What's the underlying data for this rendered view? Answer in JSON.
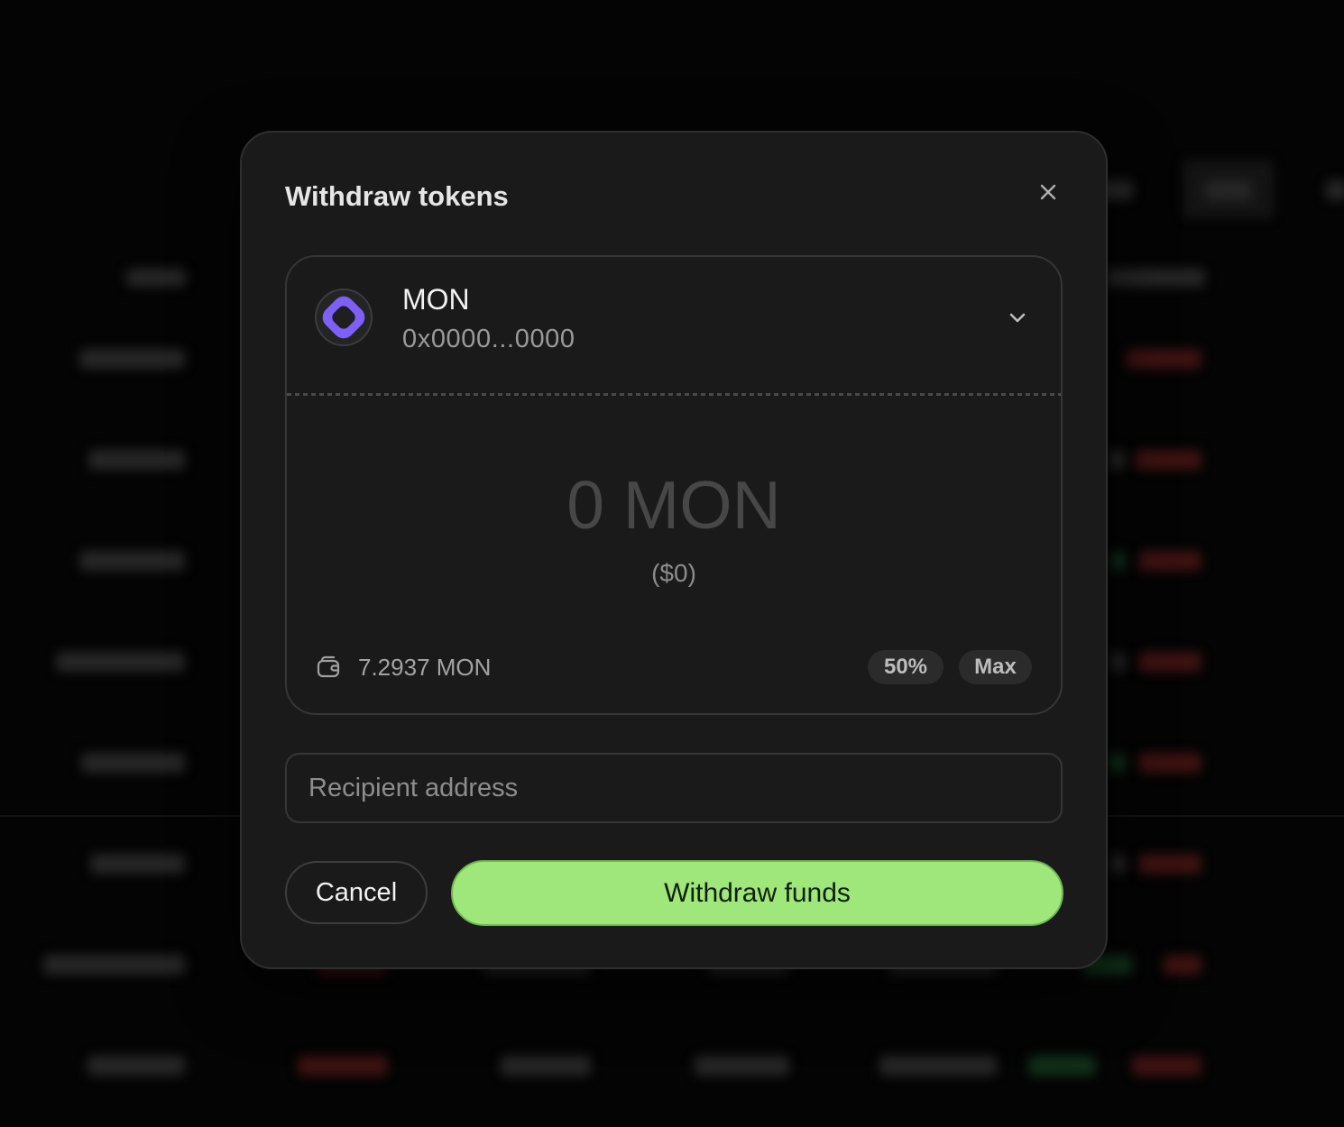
{
  "modal": {
    "title": "Withdraw tokens",
    "close_icon": "close-icon"
  },
  "token": {
    "symbol": "MON",
    "address": "0x0000...0000",
    "icon": "mon-token-icon",
    "dropdown_icon": "chevron-down-icon"
  },
  "amount": {
    "placeholder": "0 MON",
    "usd_value": "($0)"
  },
  "balance": {
    "icon": "wallet-icon",
    "value": "7.2937 MON"
  },
  "quick_amounts": {
    "half": "50%",
    "max": "Max"
  },
  "recipient": {
    "placeholder": "Recipient address"
  },
  "actions": {
    "cancel": "Cancel",
    "submit": "Withdraw funds"
  },
  "colors": {
    "accent": "#9fe67b",
    "token": "#7e60f8",
    "surface": "#1a1a1a",
    "backdrop": "#040404"
  }
}
